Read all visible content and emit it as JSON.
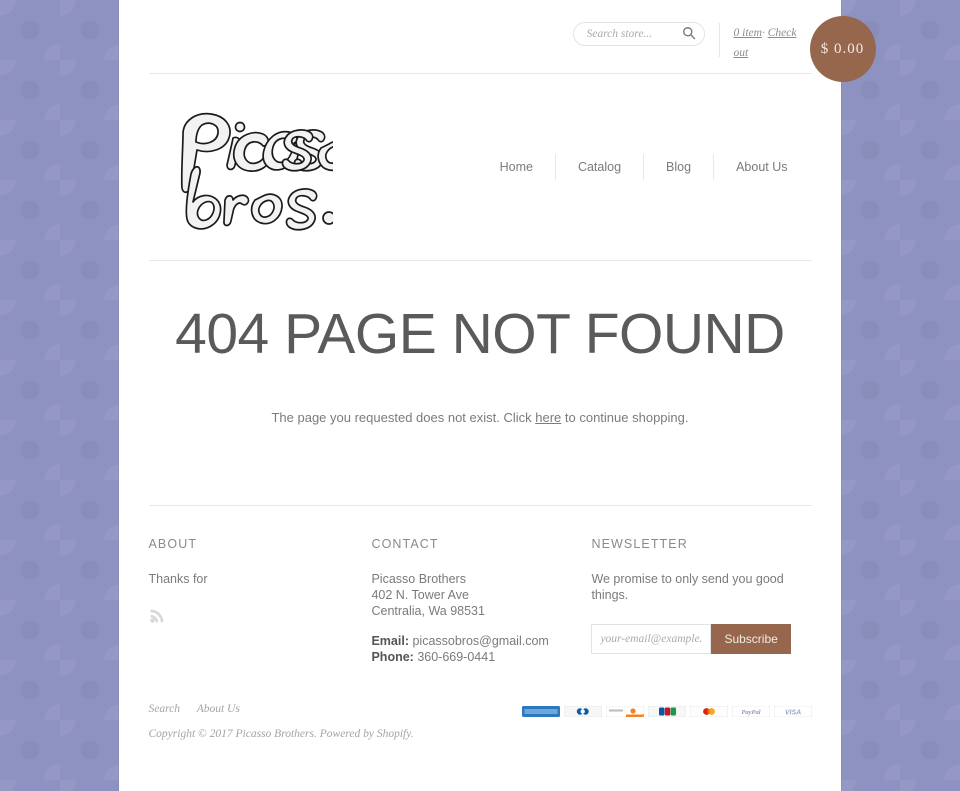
{
  "site": {
    "logo_text": "Picasso bros.",
    "brand_color": "#97674d",
    "background_color": "#8e92c0"
  },
  "topbar": {
    "search": {
      "placeholder": "Search store...",
      "value": "",
      "icon": "search-icon",
      "submit_label": "Search"
    },
    "cart": {
      "item_count_label": "0 item",
      "separator": "·",
      "checkout_label": "Check out",
      "total": "$ 0.00"
    }
  },
  "nav": {
    "items": [
      {
        "label": "Home"
      },
      {
        "label": "Catalog"
      },
      {
        "label": "Blog"
      },
      {
        "label": "About Us"
      }
    ]
  },
  "main": {
    "title": "404 PAGE NOT FOUND",
    "message_before": "The page you requested does not exist. Click ",
    "message_link": "here",
    "message_after": " to continue shopping."
  },
  "footer": {
    "about": {
      "heading": "ABOUT",
      "text": "Thanks for",
      "rss_icon": "rss-icon"
    },
    "contact": {
      "heading": "CONTACT",
      "name": "Picasso Brothers",
      "street": "402 N. Tower Ave",
      "city": "Centralia, Wa 98531",
      "email_label": "Email:",
      "email": "picassobros@gmail.com",
      "phone_label": "Phone:",
      "phone": "360-669-0441"
    },
    "newsletter": {
      "heading": "NEWSLETTER",
      "text": "We promise to only send you good things.",
      "input_placeholder": "your-email@example.com",
      "input_value": "",
      "button_label": "Subscribe"
    }
  },
  "bottom": {
    "links": [
      {
        "label": "Search"
      },
      {
        "label": "About Us"
      }
    ],
    "copyright_before": "Copyright © 2017 ",
    "copyright_shop": "Picasso Brothers",
    "copyright_mid": ". Powered by ",
    "copyright_platform": "Shopify",
    "copyright_end": ".",
    "payment_methods": [
      {
        "name": "American Express"
      },
      {
        "name": "Diners Club"
      },
      {
        "name": "Discover"
      },
      {
        "name": "JCB"
      },
      {
        "name": "Master"
      },
      {
        "name": "PayPal"
      },
      {
        "name": "Visa"
      }
    ]
  }
}
